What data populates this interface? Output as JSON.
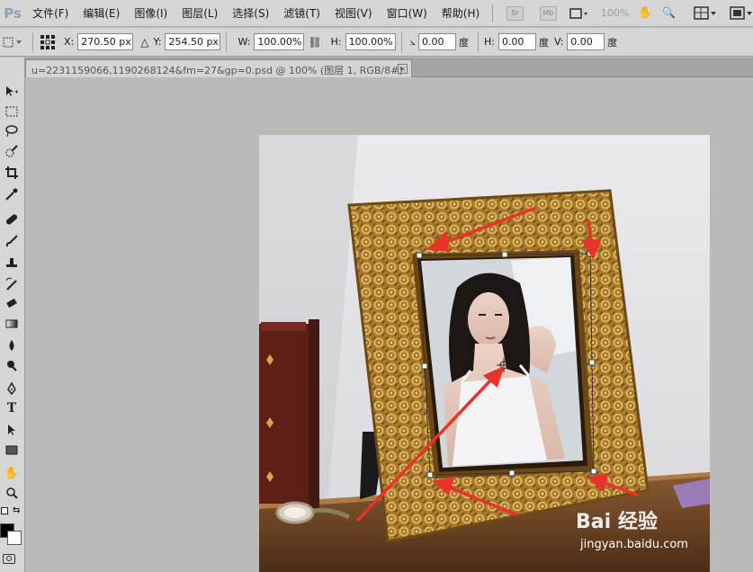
{
  "app": {
    "logo": "Ps"
  },
  "menu": [
    {
      "label": "文件(F)"
    },
    {
      "label": "编辑(E)"
    },
    {
      "label": "图像(I)"
    },
    {
      "label": "图层(L)"
    },
    {
      "label": "选择(S)"
    },
    {
      "label": "滤镜(T)"
    },
    {
      "label": "视图(V)"
    },
    {
      "label": "窗口(W)"
    },
    {
      "label": "帮助(H)"
    }
  ],
  "menubar_right": {
    "br": "Br",
    "mb": "Mb",
    "zoom": "100%"
  },
  "options": {
    "x_label": "X:",
    "x_value": "270.50 px",
    "y_label": "Y:",
    "y_value": "254.50 px",
    "w_label": "W:",
    "w_value": "100.00%",
    "h_label": "H:",
    "h_value": "100.00%",
    "angle_value": "0.00",
    "angle_unit": "度",
    "hskew_label": "H:",
    "hskew_value": "0.00",
    "hskew_unit": "度",
    "vskew_label": "V:",
    "vskew_value": "0.00",
    "vskew_unit": "度"
  },
  "document": {
    "tab_title": "u=2231159066,1190268124&fm=27&gp=0.psd  @  100%  (图层 1, RGB/8#)",
    "close": "×"
  },
  "watermark": {
    "brand": "Bai 经验",
    "url": "jingyan.baidu.com"
  },
  "colors": {
    "accent_arrow": "#e8332b",
    "frame_gold": "#b8862e"
  }
}
